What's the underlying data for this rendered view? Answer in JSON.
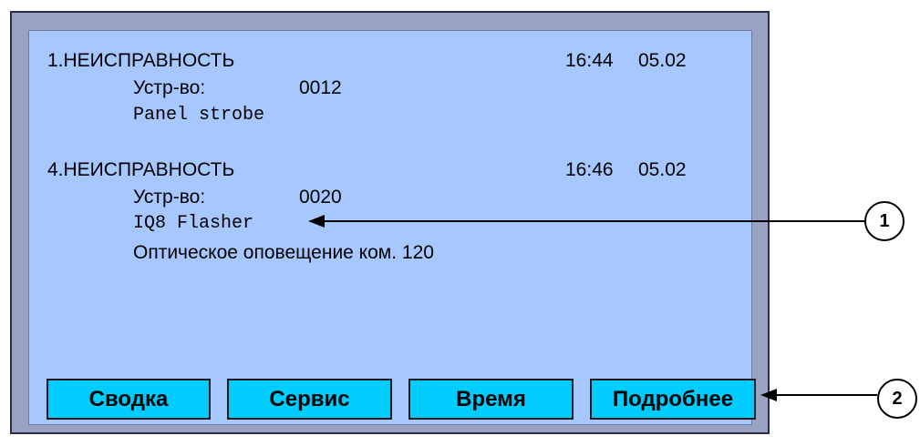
{
  "messages": [
    {
      "header": "1.НЕИСПРАВНОСТЬ",
      "time": "16:44",
      "date": "05.02",
      "device_label": "Устр-во:",
      "device_number": "0012",
      "device_name": "Panel strobe"
    },
    {
      "header": "4.НЕИСПРАВНОСТЬ",
      "time": "16:46",
      "date": "05.02",
      "device_label": "Устр-во:",
      "device_number": "0020",
      "device_name": "IQ8 Flasher",
      "description": "Оптическое оповещение ком. 120"
    }
  ],
  "buttons": {
    "summary": "Сводка",
    "service": "Сервис",
    "time": "Время",
    "details": "Подробнее"
  },
  "callouts": {
    "one": "1",
    "two": "2"
  },
  "colors": {
    "screen_bg": "#a6c8ff",
    "frame_bg": "#9aa2c4",
    "button_bg": "#00ccff"
  }
}
